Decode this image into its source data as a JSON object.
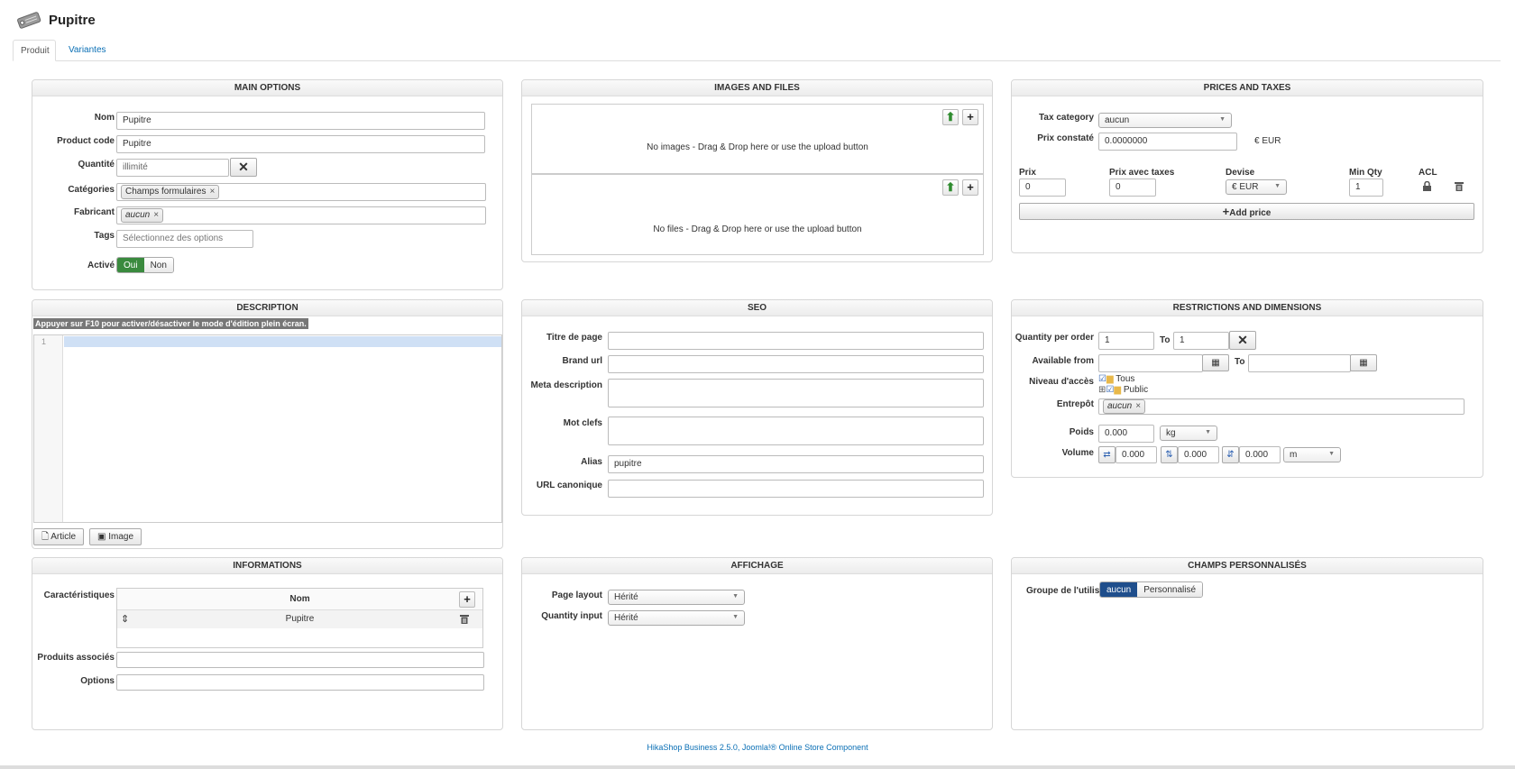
{
  "page": {
    "title": "Pupitre"
  },
  "tabs": [
    {
      "label": "Produit"
    },
    {
      "label": "Variantes"
    }
  ],
  "main_options": {
    "heading": "MAIN OPTIONS",
    "name_label": "Nom",
    "name_value": "Pupitre",
    "code_label": "Product code",
    "code_value": "Pupitre",
    "qty_label": "Quantité",
    "qty_value": "illimité",
    "cat_label": "Catégories",
    "cat_tag": "Champs formulaires",
    "manuf_label": "Fabricant",
    "manuf_tag": "aucun",
    "tags_label": "Tags",
    "tags_placeholder": "Sélectionnez des options",
    "active_label": "Activé",
    "yes": "Oui",
    "no": "Non"
  },
  "images_files": {
    "heading": "IMAGES AND FILES",
    "no_images": "No images - Drag & Drop here or use the upload button",
    "no_files": "No files - Drag & Drop here or use the upload button"
  },
  "prices": {
    "heading": "PRICES AND TAXES",
    "tax_label": "Tax category",
    "tax_value": "aucun",
    "prix_constate_label": "Prix constaté",
    "prix_constate_value": "0.0000000",
    "prix_constate_currency": "€ EUR",
    "col_prix": "Prix",
    "col_prix_taxes": "Prix avec taxes",
    "col_devise": "Devise",
    "col_minqty": "Min Qty",
    "col_acl": "ACL",
    "row": {
      "prix": "0",
      "prix_taxes": "0",
      "devise": "€ EUR",
      "minqty": "1"
    },
    "add_price": "Add price"
  },
  "description": {
    "heading": "DESCRIPTION",
    "hint": "Appuyer sur F10 pour activer/désactiver le mode d'édition plein écran.",
    "line_no": "1",
    "btn_article": "Article",
    "btn_image": "Image"
  },
  "seo": {
    "heading": "SEO",
    "titre_label": "Titre de page",
    "brand_label": "Brand url",
    "meta_label": "Meta description",
    "mots_label": "Mot clefs",
    "alias_label": "Alias",
    "alias_value": "pupitre",
    "canon_label": "URL canonique"
  },
  "restrictions": {
    "heading": "RESTRICTIONS AND DIMENSIONS",
    "qpo_label": "Quantity per order",
    "qpo_from": "1",
    "to_label": "To",
    "qpo_to": "1",
    "avail_label": "Available from",
    "avail_to_label": "To",
    "niveau_label": "Niveau d'accès",
    "tree_all": "Tous",
    "tree_public": "Public",
    "entrepot_label": "Entrepôt",
    "entrepot_tag": "aucun",
    "poids_label": "Poids",
    "poids_value": "0.000",
    "poids_unit": "kg",
    "volume_label": "Volume",
    "vol1": "0.000",
    "vol2": "0.000",
    "vol3": "0.000",
    "vol_unit": "m"
  },
  "informations": {
    "heading": "INFORMATIONS",
    "carac_label": "Caractéristiques",
    "col_nom": "Nom",
    "row_value": "Pupitre",
    "assoc_label": "Produits associés",
    "options_label": "Options"
  },
  "affichage": {
    "heading": "AFFICHAGE",
    "layout_label": "Page layout",
    "layout_value": "Hérité",
    "qinput_label": "Quantity input",
    "qinput_value": "Hérité"
  },
  "champs": {
    "heading": "CHAMPS PERSONNALISÉS",
    "groupe_label": "Groupe de l'utilis...",
    "opt_aucun": "aucun",
    "opt_perso": "Personnalisé"
  },
  "footer": {
    "text": "HikaShop Business 2.5.0, Joomla!® Online Store Component"
  }
}
